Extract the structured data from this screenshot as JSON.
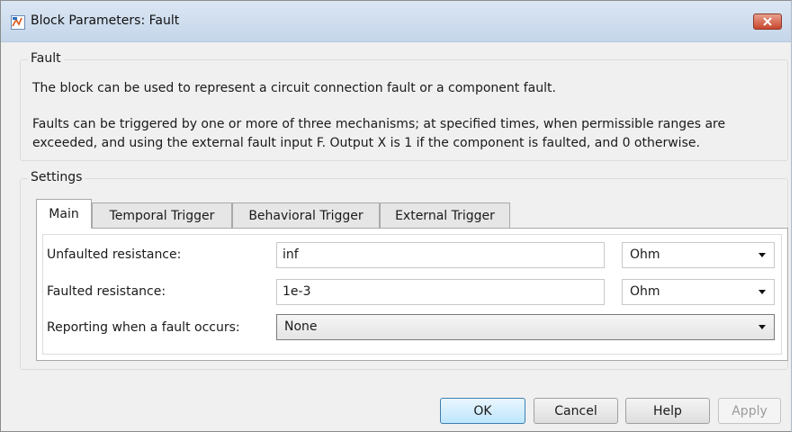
{
  "window": {
    "title": "Block Parameters: Fault"
  },
  "icons": {
    "app": "simulink-block-icon",
    "close": "close-x-icon",
    "dropdown": "chevron-down-icon"
  },
  "colors": {
    "titlebar": "#c5d6ea",
    "close_button": "#c9452c",
    "default_button_border": "#3c7fb1"
  },
  "fault_group": {
    "title": "Fault",
    "line1": "The block can be used to represent a circuit connection fault or a component fault.",
    "line2": "Faults can be triggered by one or more of three mechanisms; at specified times, when permissible ranges are",
    "line3": "exceeded, and using the external fault input F. Output X is 1 if the component is faulted, and 0 otherwise."
  },
  "settings": {
    "title": "Settings",
    "tabs": [
      {
        "label": "Main",
        "active": true
      },
      {
        "label": "Temporal Trigger",
        "active": false
      },
      {
        "label": "Behavioral Trigger",
        "active": false
      },
      {
        "label": "External Trigger",
        "active": false
      }
    ],
    "params": {
      "unfaulted_resistance": {
        "label": "Unfaulted resistance:",
        "value": "inf",
        "unit": "Ohm"
      },
      "faulted_resistance": {
        "label": "Faulted resistance:",
        "value": "1e-3",
        "unit": "Ohm"
      },
      "reporting": {
        "label": "Reporting when a fault occurs:",
        "value": "None"
      }
    }
  },
  "buttons": {
    "ok": "OK",
    "cancel": "Cancel",
    "help": "Help",
    "apply": "Apply"
  }
}
